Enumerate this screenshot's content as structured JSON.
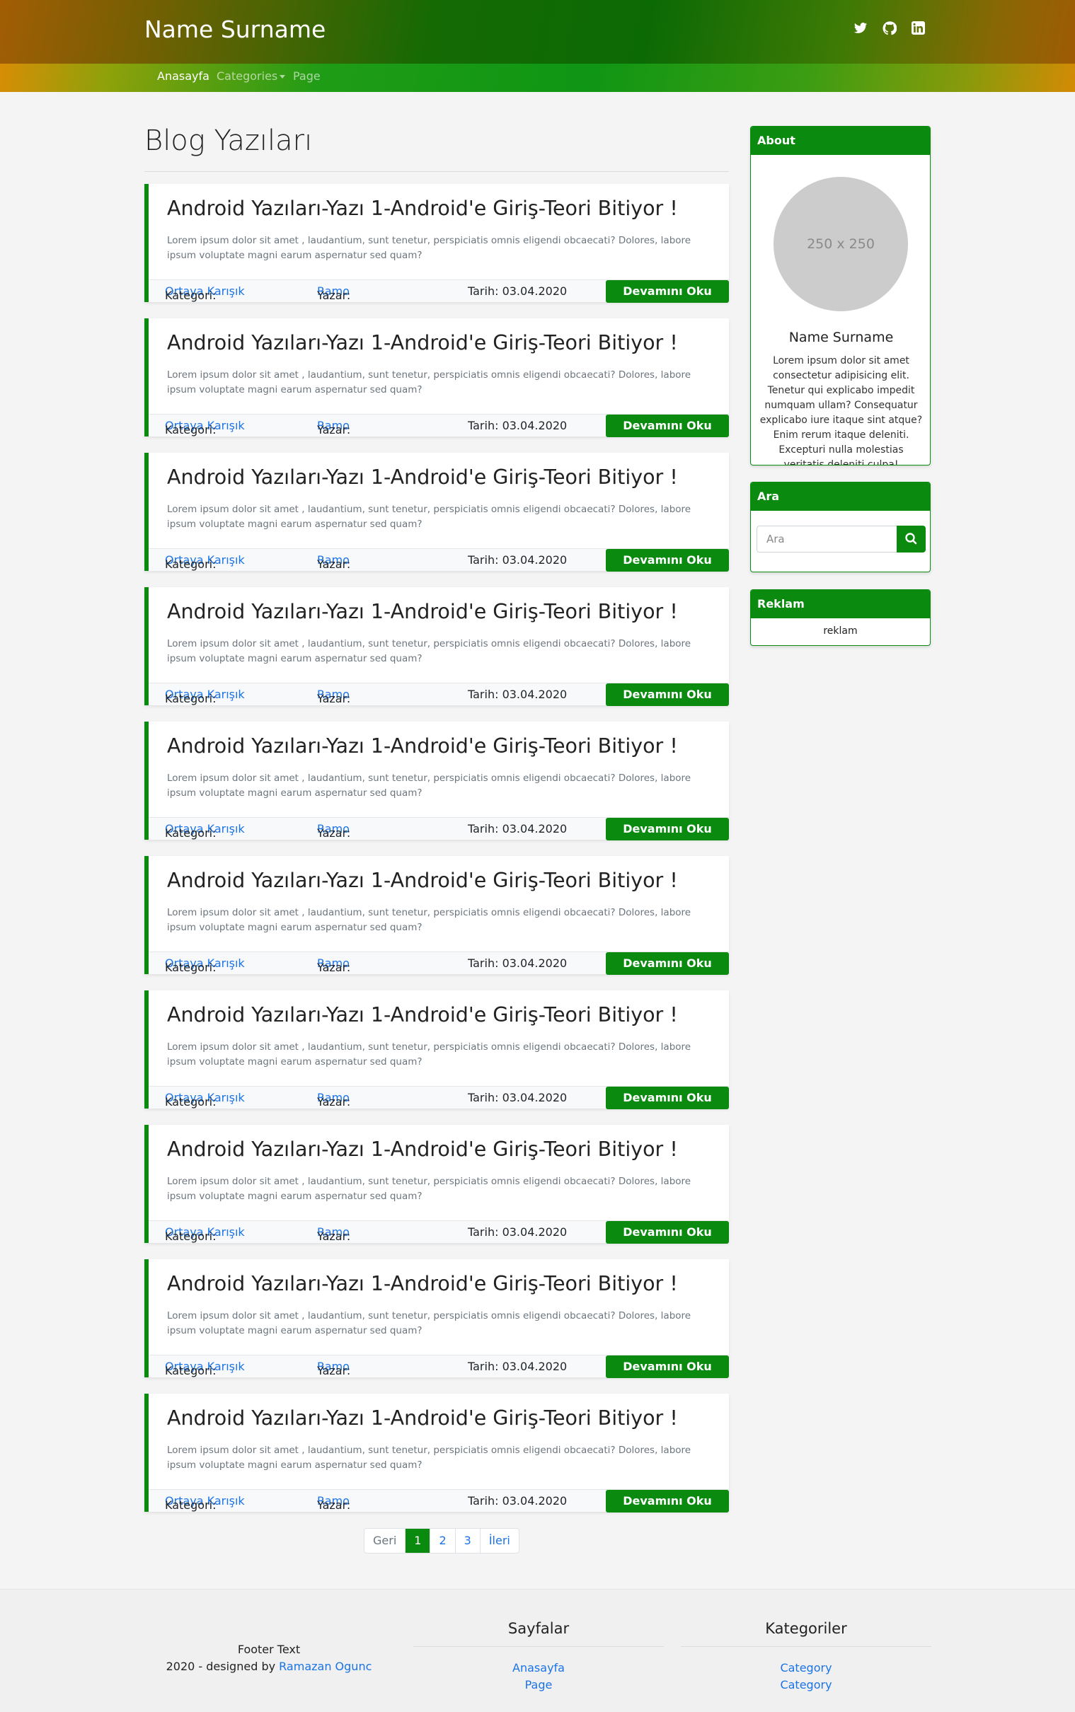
{
  "header": {
    "brand": "Name Surname",
    "nav": [
      {
        "label": "Anasayfa",
        "active": true
      },
      {
        "label": "Categories",
        "dropdown": true
      },
      {
        "label": "Page"
      }
    ],
    "social_icons": [
      "twitter-icon",
      "github-icon",
      "linkedin-icon"
    ]
  },
  "main": {
    "title": "Blog Yazıları",
    "posts": [
      {
        "title": "Android Yazıları-Yazı 1-Android'e Giriş-Teori Bitiyor !",
        "excerpt": "Lorem ipsum dolor sit amet , laudantium, sunt tenetur, perspiciatis omnis eligendi obcaecati? Dolores, labore ipsum voluptate magni earum aspernatur sed quam?",
        "category_label": "Kategori:",
        "category": "Ortaya Karışık",
        "author_label": "Yazar:",
        "author": "Ramo",
        "date": "Tarih: 03.04.2020",
        "read_more": "Devamını Oku"
      },
      {
        "title": "Android Yazıları-Yazı 1-Android'e Giriş-Teori Bitiyor !",
        "excerpt": "Lorem ipsum dolor sit amet , laudantium, sunt tenetur, perspiciatis omnis eligendi obcaecati? Dolores, labore ipsum voluptate magni earum aspernatur sed quam?",
        "category_label": "Kategori:",
        "category": "Ortaya Karışık",
        "author_label": "Yazar:",
        "author": "Ramo",
        "date": "Tarih: 03.04.2020",
        "read_more": "Devamını Oku"
      },
      {
        "title": "Android Yazıları-Yazı 1-Android'e Giriş-Teori Bitiyor !",
        "excerpt": "Lorem ipsum dolor sit amet , laudantium, sunt tenetur, perspiciatis omnis eligendi obcaecati? Dolores, labore ipsum voluptate magni earum aspernatur sed quam?",
        "category_label": "Kategori:",
        "category": "Ortaya Karışık",
        "author_label": "Yazar:",
        "author": "Ramo",
        "date": "Tarih: 03.04.2020",
        "read_more": "Devamını Oku"
      },
      {
        "title": "Android Yazıları-Yazı 1-Android'e Giriş-Teori Bitiyor !",
        "excerpt": "Lorem ipsum dolor sit amet , laudantium, sunt tenetur, perspiciatis omnis eligendi obcaecati? Dolores, labore ipsum voluptate magni earum aspernatur sed quam?",
        "category_label": "Kategori:",
        "category": "Ortaya Karışık",
        "author_label": "Yazar:",
        "author": "Ramo",
        "date": "Tarih: 03.04.2020",
        "read_more": "Devamını Oku"
      },
      {
        "title": "Android Yazıları-Yazı 1-Android'e Giriş-Teori Bitiyor !",
        "excerpt": "Lorem ipsum dolor sit amet , laudantium, sunt tenetur, perspiciatis omnis eligendi obcaecati? Dolores, labore ipsum voluptate magni earum aspernatur sed quam?",
        "category_label": "Kategori:",
        "category": "Ortaya Karışık",
        "author_label": "Yazar:",
        "author": "Ramo",
        "date": "Tarih: 03.04.2020",
        "read_more": "Devamını Oku"
      },
      {
        "title": "Android Yazıları-Yazı 1-Android'e Giriş-Teori Bitiyor !",
        "excerpt": "Lorem ipsum dolor sit amet , laudantium, sunt tenetur, perspiciatis omnis eligendi obcaecati? Dolores, labore ipsum voluptate magni earum aspernatur sed quam?",
        "category_label": "Kategori:",
        "category": "Ortaya Karışık",
        "author_label": "Yazar:",
        "author": "Ramo",
        "date": "Tarih: 03.04.2020",
        "read_more": "Devamını Oku"
      },
      {
        "title": "Android Yazıları-Yazı 1-Android'e Giriş-Teori Bitiyor !",
        "excerpt": "Lorem ipsum dolor sit amet , laudantium, sunt tenetur, perspiciatis omnis eligendi obcaecati? Dolores, labore ipsum voluptate magni earum aspernatur sed quam?",
        "category_label": "Kategori:",
        "category": "Ortaya Karışık",
        "author_label": "Yazar:",
        "author": "Ramo",
        "date": "Tarih: 03.04.2020",
        "read_more": "Devamını Oku"
      },
      {
        "title": "Android Yazıları-Yazı 1-Android'e Giriş-Teori Bitiyor !",
        "excerpt": "Lorem ipsum dolor sit amet , laudantium, sunt tenetur, perspiciatis omnis eligendi obcaecati? Dolores, labore ipsum voluptate magni earum aspernatur sed quam?",
        "category_label": "Kategori:",
        "category": "Ortaya Karışık",
        "author_label": "Yazar:",
        "author": "Ramo",
        "date": "Tarih: 03.04.2020",
        "read_more": "Devamını Oku"
      },
      {
        "title": "Android Yazıları-Yazı 1-Android'e Giriş-Teori Bitiyor !",
        "excerpt": "Lorem ipsum dolor sit amet , laudantium, sunt tenetur, perspiciatis omnis eligendi obcaecati? Dolores, labore ipsum voluptate magni earum aspernatur sed quam?",
        "category_label": "Kategori:",
        "category": "Ortaya Karışık",
        "author_label": "Yazar:",
        "author": "Ramo",
        "date": "Tarih: 03.04.2020",
        "read_more": "Devamını Oku"
      },
      {
        "title": "Android Yazıları-Yazı 1-Android'e Giriş-Teori Bitiyor !",
        "excerpt": "Lorem ipsum dolor sit amet , laudantium, sunt tenetur, perspiciatis omnis eligendi obcaecati? Dolores, labore ipsum voluptate magni earum aspernatur sed quam?",
        "category_label": "Kategori:",
        "category": "Ortaya Karışık",
        "author_label": "Yazar:",
        "author": "Ramo",
        "date": "Tarih: 03.04.2020",
        "read_more": "Devamını Oku"
      }
    ],
    "pagination": {
      "prev": "Geri",
      "pages": [
        "1",
        "2",
        "3"
      ],
      "active": "1",
      "next": "İleri"
    }
  },
  "sidebar": {
    "about": {
      "header": "About",
      "image_text": "250 x 250",
      "name": "Name Surname",
      "text": "Lorem ipsum dolor sit amet consectetur adipisicing elit. Tenetur qui explicabo impedit numquam ullam? Consequatur explicabo iure itaque sint atque? Enim rerum itaque deleniti. Excepturi nulla molestias veritatis deleniti culpa!"
    },
    "search": {
      "header": "Ara",
      "placeholder": "Ara",
      "icon": "search-icon"
    },
    "ad": {
      "header": "Reklam",
      "text": "reklam"
    }
  },
  "footer": {
    "text": "Footer Text",
    "credit_prefix": "2020 - designed by",
    "credit_link": "Ramazan Ogunc",
    "pages_title": "Sayfalar",
    "pages": [
      "Anasayfa",
      "Page"
    ],
    "categories_title": "Kategoriler",
    "categories": [
      "Category",
      "Category"
    ]
  },
  "colors": {
    "accent": "#0b8a10",
    "link": "#1a73e8"
  }
}
